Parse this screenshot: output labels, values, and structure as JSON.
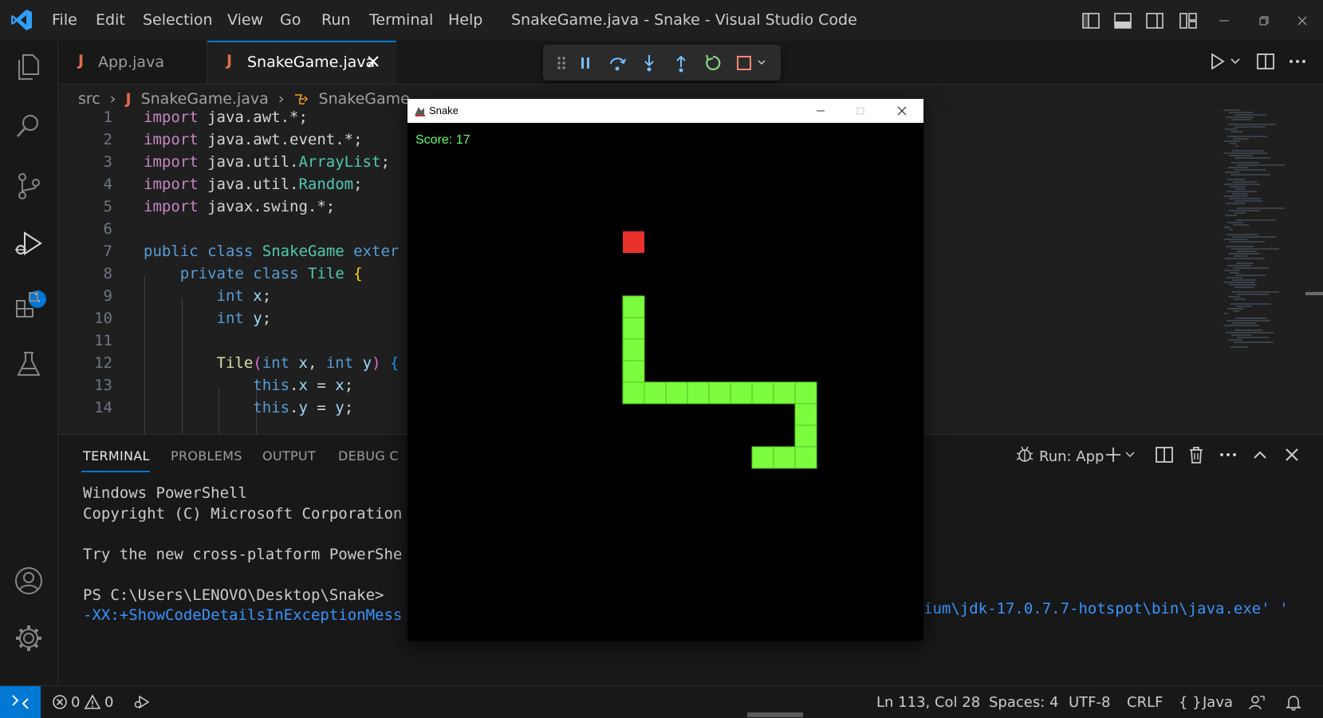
{
  "titlebar": {
    "menu": [
      "File",
      "Edit",
      "Selection",
      "View",
      "Go",
      "Run",
      "Terminal",
      "Help"
    ],
    "window_title": "SnakeGame.java - Snake - Visual Studio Code"
  },
  "activity_bar": {
    "debug_badge": "1"
  },
  "tabs": [
    {
      "icon": "J",
      "label": "App.java"
    },
    {
      "icon": "J",
      "label": "SnakeGame.java"
    }
  ],
  "breadcrumb": {
    "folder": "src",
    "file_icon": "J",
    "file": "SnakeGame.java",
    "symbol": "SnakeGame"
  },
  "editor": {
    "line_numbers": [
      "1",
      "2",
      "3",
      "4",
      "5",
      "6",
      "7",
      "8",
      "9",
      "10",
      "11",
      "12",
      "13",
      "14"
    ]
  },
  "panel": {
    "tabs": [
      "TERMINAL",
      "PROBLEMS",
      "OUTPUT",
      "DEBUG C"
    ],
    "run_label": "Run: App",
    "terminal_lines": [
      "Windows PowerShell",
      "Copyright (C) Microsoft Corporation",
      "",
      "Try the new cross-platform PowerShe",
      "",
      "PS C:\\Users\\LENOVO\\Desktop\\Snake>",
      "-XX:+ShowCodeDetailsInExceptionMess"
    ],
    "terminal_right_fragment": "ium\\jdk-17.0.7.7-hotspot\\bin\\java.exe' '"
  },
  "statusbar": {
    "errors": "0",
    "warnings": "0",
    "position": "Ln 113, Col 28",
    "spaces": "Spaces: 4",
    "encoding": "UTF-8",
    "eol": "CRLF",
    "language_icon": "{ }",
    "language": "Java"
  },
  "snake_window": {
    "title": "Snake",
    "score": "Score: 17",
    "colors": {
      "snake": "#7cfc3e",
      "food": "#e8312a",
      "background": "#000000",
      "score": "#61ff61"
    }
  },
  "colors": {
    "accent": "#0078d4",
    "java_icon": "#e06c4b",
    "keyword": "#569cd6",
    "class_name": "#4ec9b0"
  }
}
